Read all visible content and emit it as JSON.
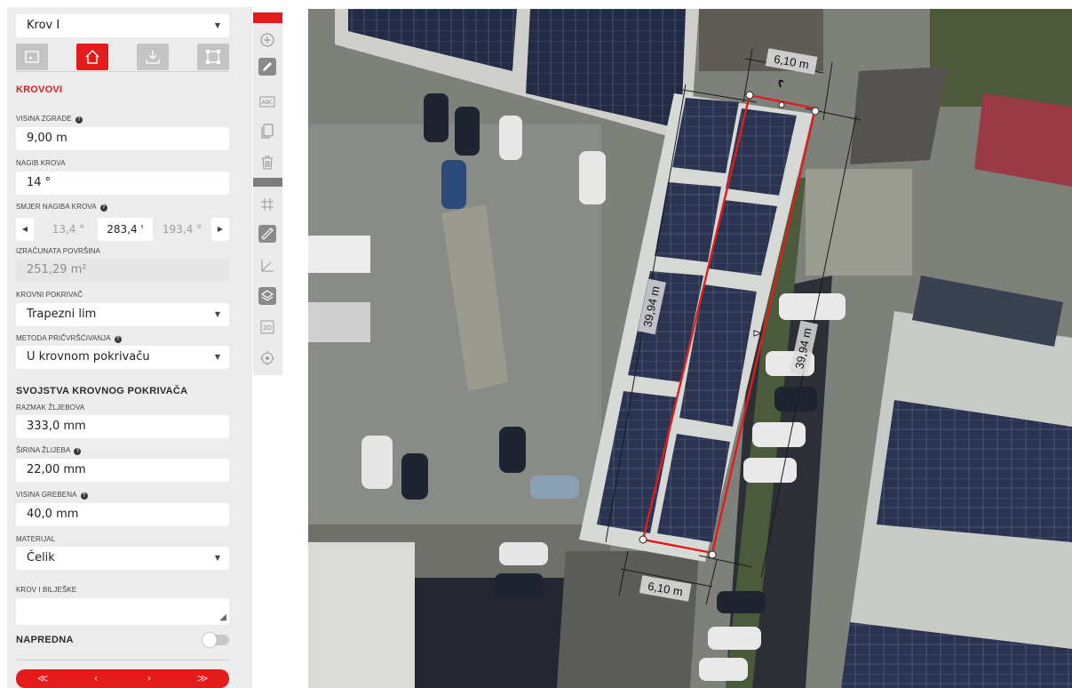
{
  "roof_select": {
    "value": "Krov I"
  },
  "tabs": [
    {
      "name": "image-tab",
      "icon": "image-icon"
    },
    {
      "name": "roof-tab",
      "icon": "house-icon",
      "active": true
    },
    {
      "name": "download-tab",
      "icon": "download-icon"
    },
    {
      "name": "area-tab",
      "icon": "area-select-icon"
    }
  ],
  "section_title": "KROVOVI",
  "fields": {
    "building_height": {
      "label": "VISINA ZGRADE",
      "value": "9,00 m"
    },
    "roof_pitch": {
      "label": "NAGIB KROVA",
      "value": "14 °"
    },
    "roof_direction": {
      "label": "SMJER NAGIBA KROVA",
      "prev": "13,4 °",
      "current": "283,4 '",
      "next": "193,4 °"
    },
    "area": {
      "label": "IZRAČUNATA POVRŠINA",
      "value": "251,29 m²"
    },
    "roof_cover": {
      "label": "KROVNI POKRIVAČ",
      "value": "Trapezni lim"
    },
    "fixing_method": {
      "label": "METODA PRIČVRŠĆIVANJA",
      "value": "U krovnom pokrivaču"
    }
  },
  "cover_section_title": "SVOJSTVA KROVNOG POKRIVAČA",
  "cover_fields": {
    "groove_spacing": {
      "label": "RAZMAK ŽLJEBOVA",
      "value": "333,0 mm"
    },
    "groove_width": {
      "label": "ŠIRINA ŽLIJEBA",
      "value": "22,00 mm"
    },
    "ridge_height": {
      "label": "VISINA GREBENA",
      "value": "40,0 mm"
    },
    "material": {
      "label": "MATERIJAL",
      "value": "Čelik"
    },
    "notes": {
      "label": "KROV I BILJEŠKE",
      "value": ""
    }
  },
  "advanced": {
    "label": "NAPREDNA",
    "enabled": false
  },
  "nav": {
    "first": "≪",
    "prev": "‹",
    "next": "›",
    "last": "≫"
  },
  "toolbar": [
    "add-icon",
    "pencil-icon",
    "text-icon",
    "copy-icon",
    "trash-icon",
    "grid-icon",
    "ruler-icon",
    "angle-icon",
    "layers-icon",
    "2d-icon",
    "locate-icon"
  ],
  "toolbar_2d_label": "2D",
  "toolbar_text_label": "ABC",
  "map": {
    "dim_top": "6,10 m",
    "dim_bottom": "6,10 m",
    "dim_left": "39,94 m",
    "dim_right": "39,94 m",
    "outline_color": "#e31b1b"
  },
  "colors": {
    "accent": "#e31b1b",
    "panel": "#ececec"
  }
}
